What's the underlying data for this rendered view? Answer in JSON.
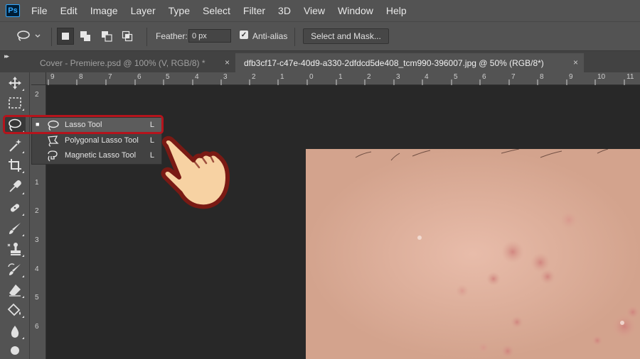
{
  "app": {
    "logo_text": "Ps",
    "accent": "#31a8ff"
  },
  "menubar": {
    "items": [
      "File",
      "Edit",
      "Image",
      "Layer",
      "Type",
      "Select",
      "Filter",
      "3D",
      "View",
      "Window",
      "Help"
    ]
  },
  "options": {
    "feather_label": "Feather:",
    "feather_value": "0 px",
    "antialias_label": "Anti-alias",
    "antialias_checked": true,
    "select_mask_label": "Select and Mask..."
  },
  "tabs": [
    {
      "label": "Cover - Premiere.psd @ 100% (V, RGB/8) *",
      "close": "×",
      "active": false
    },
    {
      "label": "dfb3cf17-c47e-40d9-a330-2dfdcd5de408_tcm990-396007.jpg @ 50% (RGB/8*)",
      "close": "×",
      "active": true
    }
  ],
  "ruler": {
    "top_labels": [
      "9",
      "8",
      "7",
      "6",
      "5",
      "4",
      "3",
      "2",
      "1",
      "0",
      "1",
      "2",
      "3",
      "4",
      "5",
      "6",
      "7",
      "8",
      "9",
      "10",
      "11"
    ],
    "left_labels": [
      "2",
      "1",
      "1",
      "2",
      "3",
      "4",
      "5",
      "6"
    ]
  },
  "flyout": {
    "items": [
      {
        "label": "Lasso Tool",
        "key": "L",
        "icon": "lasso-icon",
        "selected": true
      },
      {
        "label": "Polygonal Lasso Tool",
        "key": "L",
        "icon": "polygonal-lasso-icon",
        "selected": false
      },
      {
        "label": "Magnetic Lasso Tool",
        "key": "L",
        "icon": "magnetic-lasso-icon",
        "selected": false
      }
    ],
    "bullet": "■"
  },
  "toolbar": {
    "tools": [
      "move-icon",
      "marquee-icon",
      "lasso-icon",
      "magic-wand-icon",
      "crop-icon",
      "eyedropper-icon",
      "healing-brush-icon",
      "brush-icon",
      "clone-stamp-icon",
      "history-brush-icon",
      "eraser-icon",
      "paint-bucket-icon",
      "blur-icon",
      "dodge-icon"
    ],
    "active": "lasso-icon"
  },
  "colors": {
    "highlight": "#b5141c",
    "skin": "#dcae98",
    "canvas": "#282828"
  }
}
